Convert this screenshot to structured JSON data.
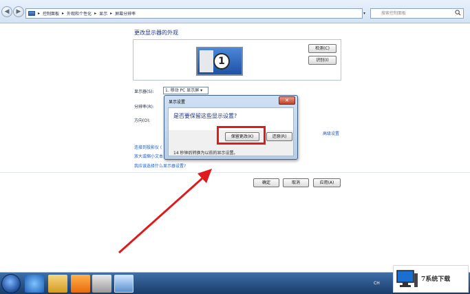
{
  "addressbar": {
    "breadcrumbs": [
      "控制面板",
      "外观和个性化",
      "显示",
      "屏幕分辨率"
    ],
    "search_placeholder": "搜索控制面板",
    "back_icon": "back-arrow-icon",
    "forward_icon": "forward-arrow-icon"
  },
  "page": {
    "title": "更改显示器的外观",
    "detect_label": "检测(C)",
    "identify_label": "识别(I)",
    "monitor_number": "1",
    "display_label": "显示器(S):",
    "display_value": "1. 移动 PC 显示屏",
    "resolution_label": "分辨率(R):",
    "orientation_label": "方向(O):",
    "advanced_link": "高级设置",
    "links": [
      "连接到投影仪 (",
      "放大或缩小文本",
      "我应该选择什么显示器设置?"
    ],
    "ok_label": "确定",
    "cancel_label": "取消",
    "apply_label": "应用(A)"
  },
  "dialog": {
    "title": "显示设置",
    "question": "是否要保留这些显示设置?",
    "keep_label": "保留更改(K)",
    "revert_label": "还原(R)",
    "countdown_note": "14 秒钟后转换为以前的显示设置。",
    "close_label": "✕"
  },
  "taskbar": {
    "tray_text": "CH",
    "watermark": "7系统下载"
  },
  "colors": {
    "accent_blue": "#1e3287",
    "link_blue": "#1a5bc4",
    "highlight_red": "#e0191a"
  }
}
